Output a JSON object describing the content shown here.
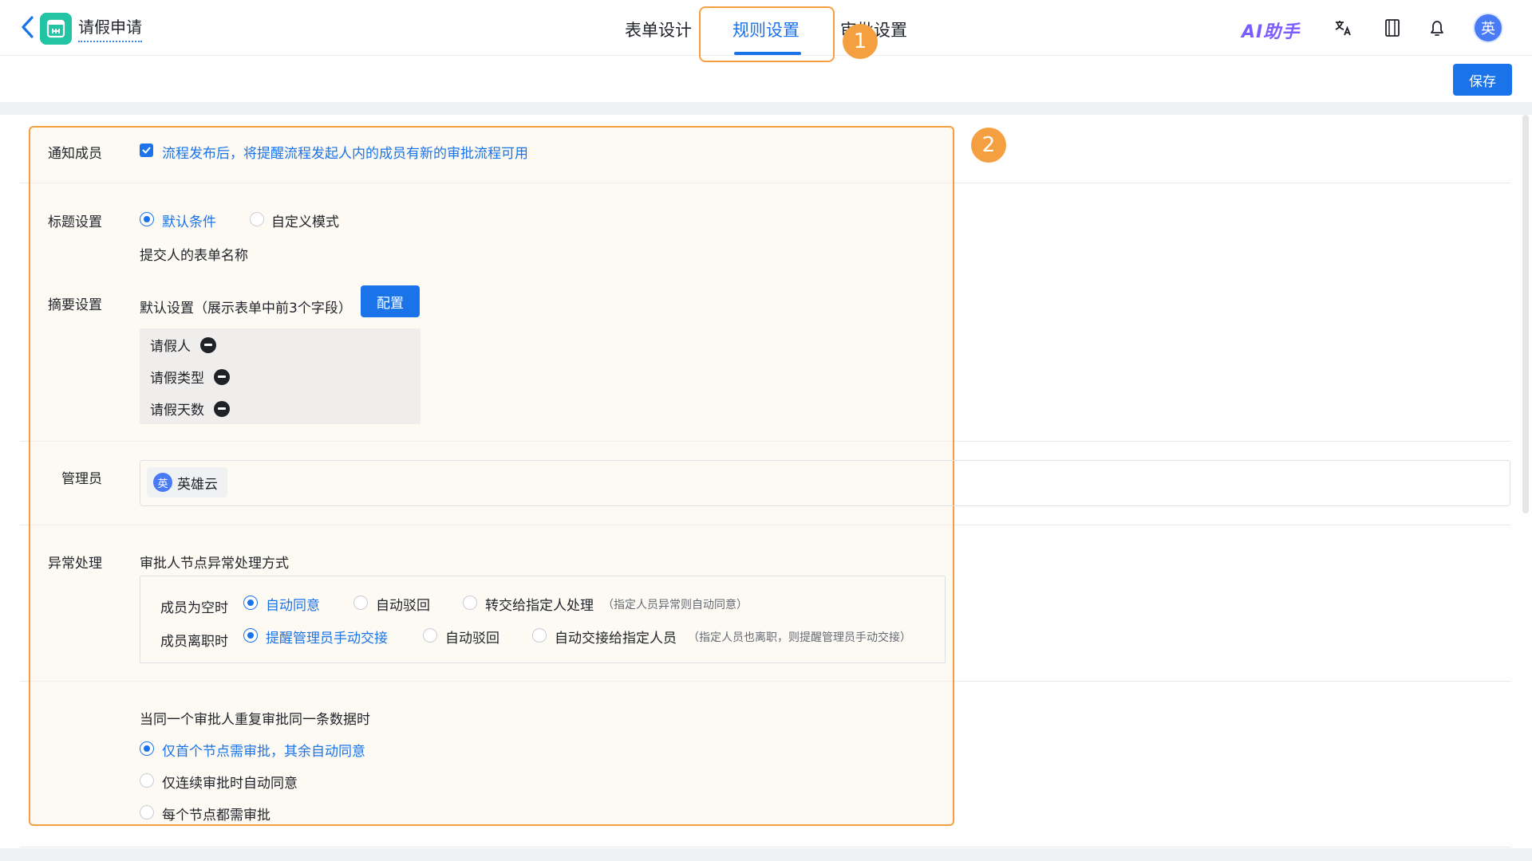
{
  "header": {
    "app_title": "请假申请",
    "tabs": [
      {
        "label": "表单设计"
      },
      {
        "label": "规则设置"
      },
      {
        "label": "审批设置"
      }
    ],
    "ai_label": "AI助手",
    "avatar_text": "英",
    "save_label": "保存"
  },
  "annotations": {
    "badge_1": "1",
    "badge_2": "2"
  },
  "notify": {
    "label": "通知成员",
    "checkbox_text": "流程发布后，将提醒流程发起人内的成员有新的审批流程可用",
    "checked": true
  },
  "title_setting": {
    "label": "标题设置",
    "options": [
      "默认条件",
      "自定义模式"
    ],
    "selected": "默认条件",
    "value": "提交人的表单名称"
  },
  "summary": {
    "label": "摘要设置",
    "desc": "默认设置（展示表单中前3个字段）",
    "config_label": "配置",
    "fields": [
      "请假人",
      "请假类型",
      "请假天数"
    ]
  },
  "admin": {
    "label": "管理员",
    "user_avatar": "英",
    "user_name": "英雄云"
  },
  "exception": {
    "label": "异常处理",
    "subtitle": "审批人节点异常处理方式",
    "row1": {
      "label": "成员为空时",
      "options": [
        "自动同意",
        "自动驳回",
        "转交给指定人处理"
      ],
      "hint": "（指定人员异常则自动同意）",
      "selected": "自动同意"
    },
    "row2": {
      "label": "成员离职时",
      "options": [
        "提醒管理员手动交接",
        "自动驳回",
        "自动交接给指定人员"
      ],
      "hint": "（指定人员也离职，则提醒管理员手动交接）",
      "selected": "提醒管理员手动交接"
    }
  },
  "duplicate": {
    "question": "当同一个审批人重复审批同一条数据时",
    "options": [
      "仅首个节点需审批，其余自动同意",
      "仅连续审批时自动同意",
      "每个节点都需审批"
    ],
    "selected": "仅首个节点需审批，其余自动同意"
  },
  "colors": {
    "accent": "#1a73e8",
    "annotation": "#f5a040",
    "app_icon": "#22c4a3"
  }
}
